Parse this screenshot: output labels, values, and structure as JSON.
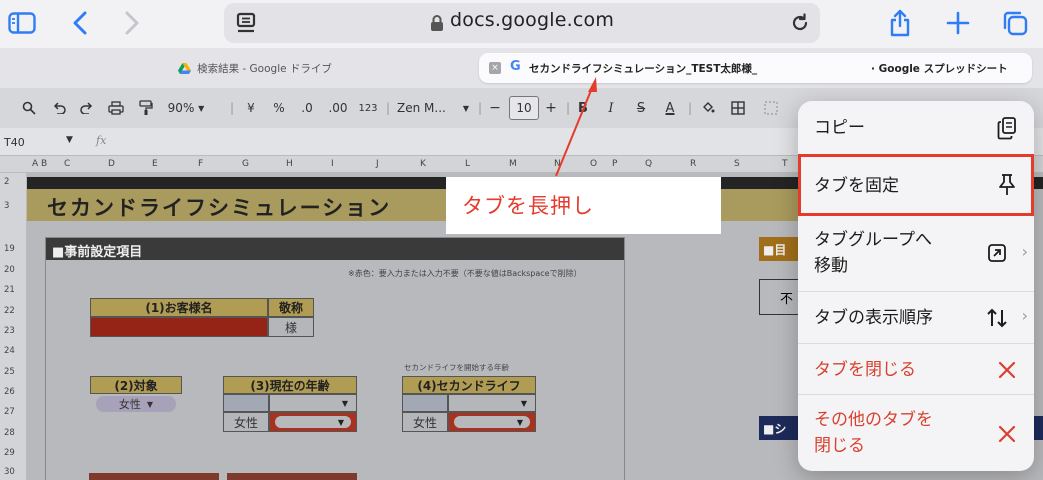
{
  "browser": {
    "url": "docs.google.com",
    "accent": "#2f7df6"
  },
  "tabs": [
    {
      "label": "検索結果 - Google ドライブ"
    },
    {
      "label": "セカンドライフシミュレーション_TEST太郎様_",
      "suffix": "· Google スプレッドシート"
    }
  ],
  "toolbar": {
    "zoom": "90%",
    "currency": "¥",
    "percent": "%",
    "dec_dec": ".0",
    "dec_inc": ".00",
    "number_format": "123",
    "font": "Zen M...",
    "font_size": "10",
    "minus": "−",
    "plus": "+",
    "bold": "B",
    "italic": "I",
    "strike": "S",
    "text_color": "A"
  },
  "formula_bar": {
    "cell_ref": "T40",
    "fx": "fx"
  },
  "columns": [
    "A",
    "B",
    "C",
    "D",
    "E",
    "F",
    "G",
    "H",
    "I",
    "J",
    "K",
    "L",
    "M",
    "N",
    "O",
    "P",
    "Q",
    "R",
    "S",
    "T"
  ],
  "rows": [
    "2",
    "3",
    "19",
    "20",
    "21",
    "22",
    "23",
    "24",
    "25",
    "26",
    "27",
    "28",
    "29",
    "30"
  ],
  "sheet": {
    "title": "セカンドライフシミュレーション",
    "section_title": "■事前設定項目",
    "note": "※赤色：要入力または入力不要（不要な値はBackspaceで削除）",
    "customer_name_hdr": "(1)お客様名",
    "honorific_hdr": "敬称",
    "honorific_value": "様",
    "target_hdr": "(2)対象",
    "target_value": "女性",
    "current_age_hdr": "(3)現在の年齢",
    "current_age_gender": "女性",
    "second_life_caption": "セカンドライフを開始する年齢",
    "second_life_hdr": "(4)セカンドライフ",
    "second_life_gender": "女性",
    "right_top_label": "■目",
    "right_box_label": "不",
    "right_bottom_label": "■シ"
  },
  "annotation": {
    "text": "タブを長押し",
    "color": "#e53b2c"
  },
  "context_menu": {
    "items": [
      {
        "label": "コピー",
        "icon": "copy-icon"
      },
      {
        "label": "タブを固定",
        "icon": "pin-icon",
        "highlighted": true
      },
      {
        "label": "タブグループへ",
        "label2": "移動",
        "icon": "move-to-group-icon"
      },
      {
        "label": "タブの表示順序",
        "icon": "sort-order-icon"
      },
      {
        "label": "タブを閉じる",
        "icon": "close-icon"
      },
      {
        "label": "その他のタブを",
        "label2": "閉じる",
        "icon": "close-others-icon"
      }
    ]
  }
}
